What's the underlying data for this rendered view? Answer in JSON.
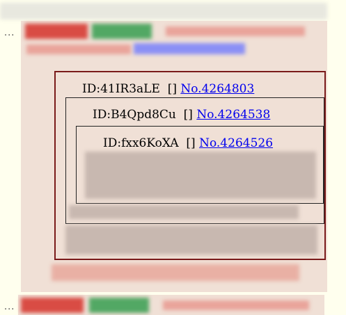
{
  "gutter": {
    "marker_1": "...",
    "marker_2": "..."
  },
  "quotes": [
    {
      "id_text": "ID:41IR3aLE",
      "brackets": "[]",
      "number": "No.4264803"
    },
    {
      "id_text": "ID:B4Qpd8Cu",
      "brackets": "[]",
      "number": "No.4264538"
    },
    {
      "id_text": "ID:fxx6KoXA",
      "brackets": "[]",
      "number": "No.4264526"
    }
  ]
}
